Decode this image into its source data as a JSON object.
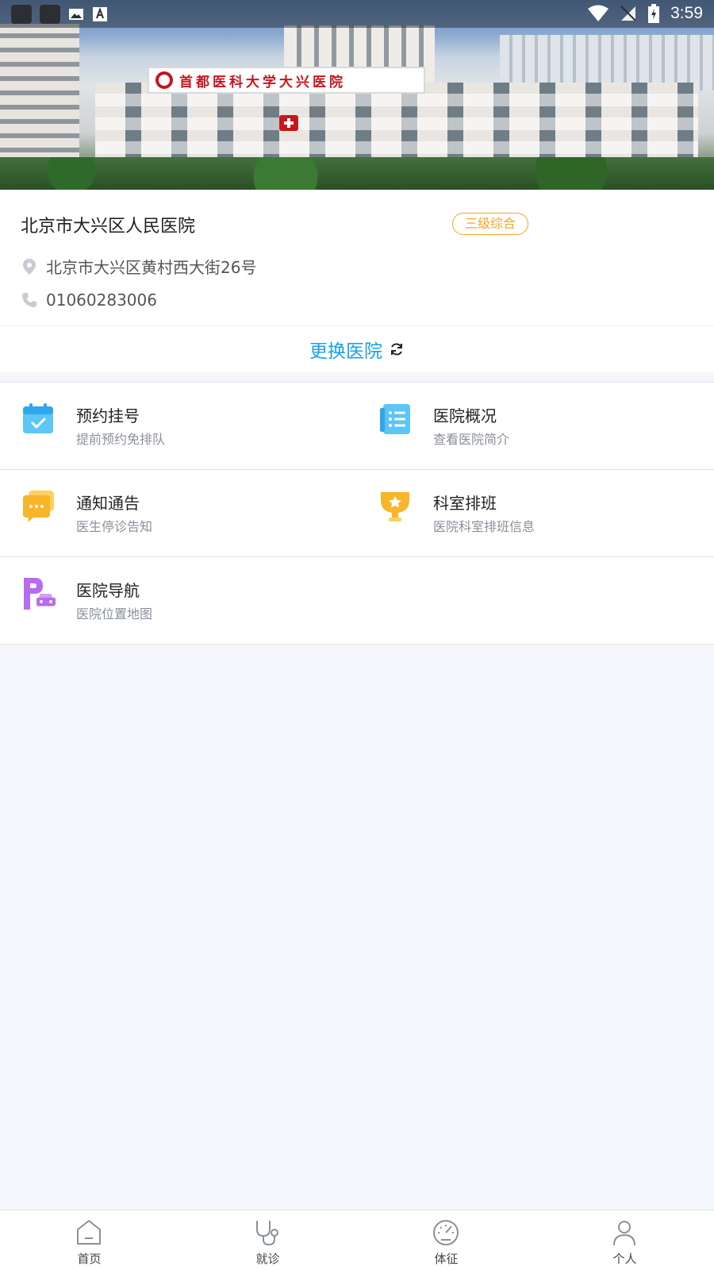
{
  "status_bar": {
    "time": "3:59",
    "left_icons": [
      "app-icon-1",
      "app-icon-2",
      "image-icon",
      "a-icon"
    ],
    "right_icons": [
      "wifi-icon",
      "signal-icon",
      "battery-icon"
    ]
  },
  "banner": {
    "sign_text": "首都医科大学大兴医院"
  },
  "hospital": {
    "name": "北京市大兴区人民医院",
    "level_badge": "三级综合",
    "address": "北京市大兴区黄村西大街26号",
    "phone": "01060283006"
  },
  "switch_hospital": {
    "label": "更换医院",
    "icon": "refresh-icon"
  },
  "services": [
    {
      "title": "预约挂号",
      "subtitle": "提前预约免排队",
      "icon": "calendar-check-icon",
      "color": "#3ab3f0"
    },
    {
      "title": "医院概况",
      "subtitle": "查看医院简介",
      "icon": "list-document-icon",
      "color": "#3ab3f0"
    },
    {
      "title": "通知通告",
      "subtitle": "医生停诊告知",
      "icon": "chat-message-icon",
      "color": "#f7b52a"
    },
    {
      "title": "科室排班",
      "subtitle": "医院科室排班信息",
      "icon": "trophy-star-icon",
      "color": "#f7b52a"
    },
    {
      "title": "医院导航",
      "subtitle": "医院位置地图",
      "icon": "parking-car-icon",
      "color": "#b66cf0"
    }
  ],
  "tabbar": [
    {
      "label": "首页",
      "icon": "home-icon"
    },
    {
      "label": "就诊",
      "icon": "stethoscope-icon"
    },
    {
      "label": "体征",
      "icon": "gauge-icon"
    },
    {
      "label": "个人",
      "icon": "user-icon"
    }
  ]
}
